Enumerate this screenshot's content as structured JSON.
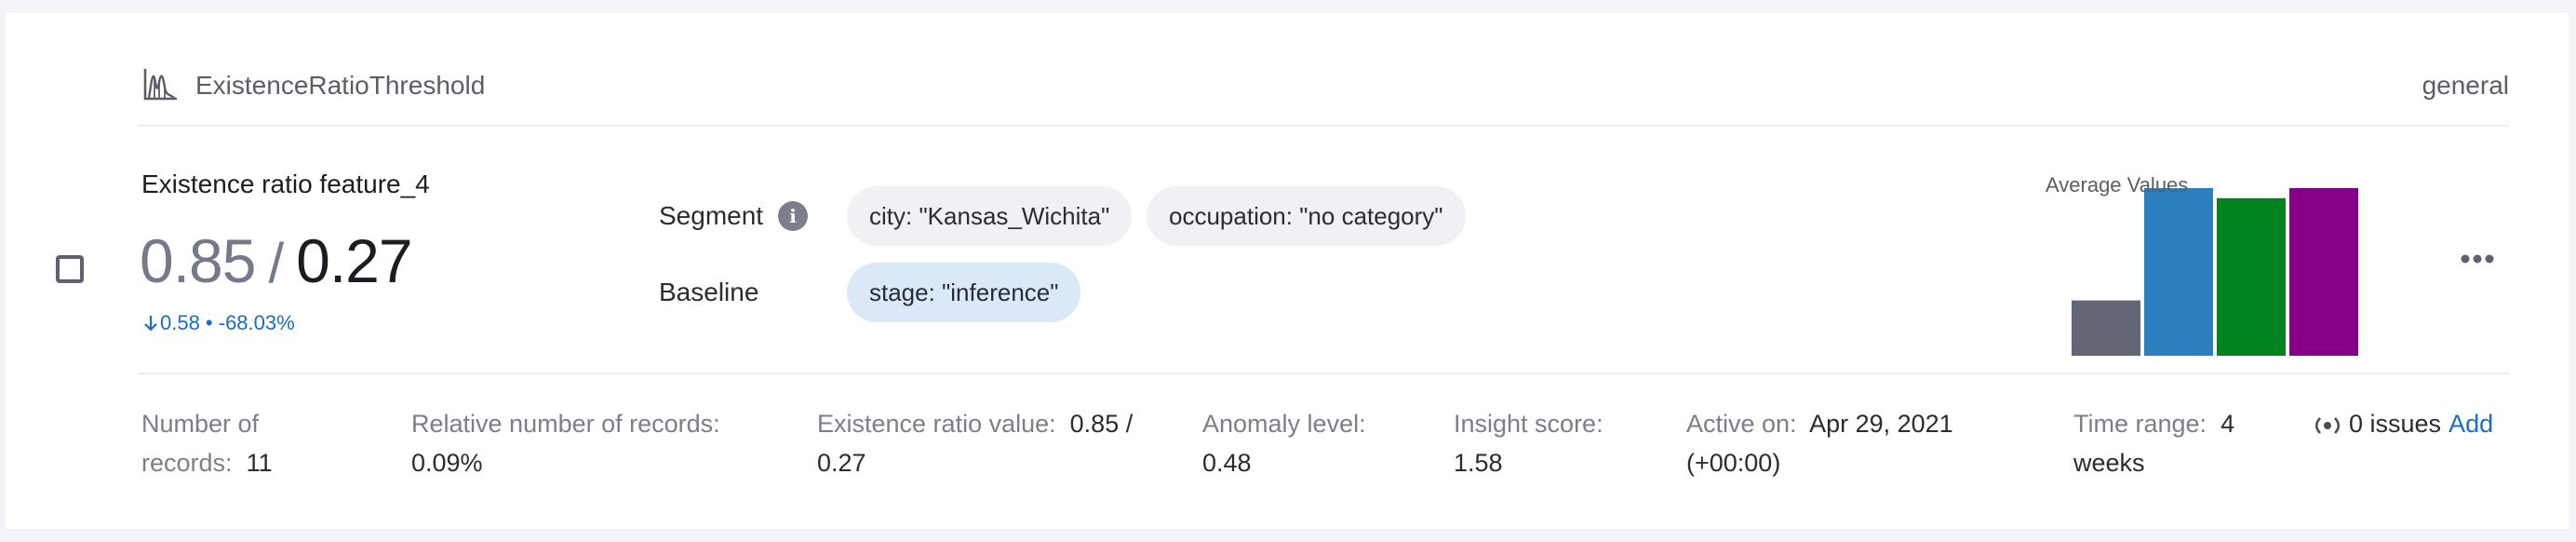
{
  "header": {
    "monitor_name": "ExistenceRatioThreshold",
    "category": "general",
    "icon": "chart-icon"
  },
  "summary": {
    "feature_title": "Existence ratio feature_4",
    "value": "0.85",
    "separator": "/",
    "baseline_value": "0.27",
    "delta": "0.58 • -68.03%",
    "delta_icon": "arrow-down-icon"
  },
  "segment": {
    "label": "Segment",
    "chips": [
      "city: \"Kansas_Wichita\"",
      "occupation: \"no category\""
    ]
  },
  "baseline": {
    "label": "Baseline",
    "chips": [
      "stage: \"inference\""
    ]
  },
  "chart_data": {
    "type": "bar",
    "title": "Average Values",
    "categories": [
      "",
      "",
      "",
      ""
    ],
    "values": [
      0.33,
      1.0,
      0.94,
      1.0
    ],
    "colors": [
      "#636775",
      "#2b7fbf",
      "#00841f",
      "#850086"
    ],
    "ylim": [
      0,
      1
    ],
    "grid": false
  },
  "stats": {
    "records_label": "Number of records:",
    "records_value": "11",
    "relative_label": "Relative number of records:",
    "relative_value": "0.09%",
    "ratio_label": "Existence ratio value:",
    "ratio_value": "0.85 / 0.27",
    "anomaly_label": "Anomaly level:",
    "anomaly_value": "0.48",
    "insight_label": "Insight score:",
    "insight_value": "1.58",
    "active_label": "Active on:",
    "active_value": "Apr 29, 2021 (+00:00)",
    "time_label": "Time range:",
    "time_value": "4 weeks"
  },
  "issues": {
    "text": "0 issues",
    "add_label": "Add"
  },
  "colors": {
    "accent": "#1c6cc4",
    "baseline_chip": "#dbe8f7",
    "segment_chip": "#f0f1f5"
  }
}
